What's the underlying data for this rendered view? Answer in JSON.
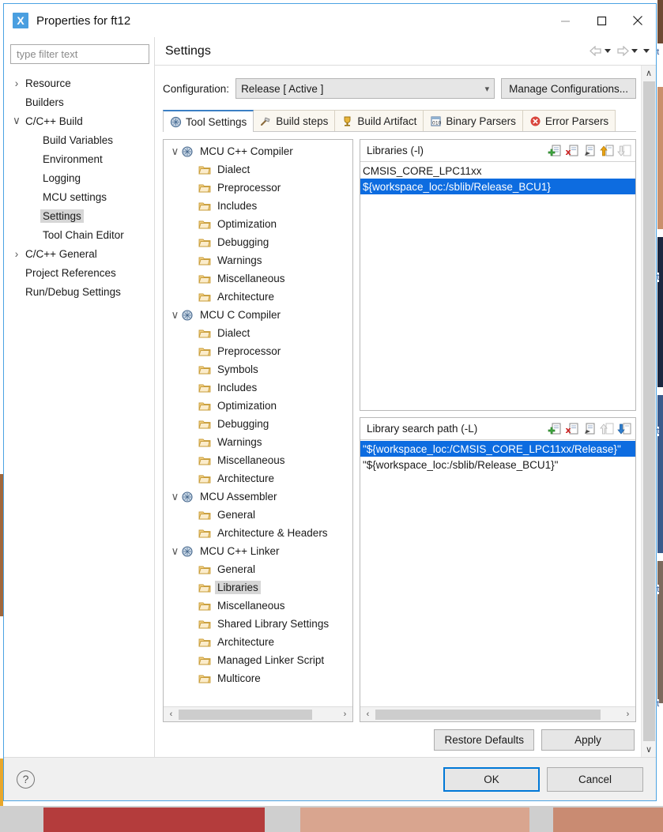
{
  "window": {
    "title": "Properties for ft12",
    "icon": "eclipse-x-icon",
    "minimize_label": "—",
    "maximize_label": "☐",
    "close_label": "✕"
  },
  "sidebar": {
    "filter_placeholder": "type filter text",
    "items": [
      {
        "label": "Resource",
        "indent": 0,
        "twisty": "collapsed",
        "selected": false
      },
      {
        "label": "Builders",
        "indent": 0,
        "twisty": "none",
        "selected": false
      },
      {
        "label": "C/C++ Build",
        "indent": 0,
        "twisty": "expanded",
        "selected": false
      },
      {
        "label": "Build Variables",
        "indent": 1,
        "twisty": "none",
        "selected": false
      },
      {
        "label": "Environment",
        "indent": 1,
        "twisty": "none",
        "selected": false
      },
      {
        "label": "Logging",
        "indent": 1,
        "twisty": "none",
        "selected": false
      },
      {
        "label": "MCU settings",
        "indent": 1,
        "twisty": "none",
        "selected": false
      },
      {
        "label": "Settings",
        "indent": 1,
        "twisty": "none",
        "selected": true
      },
      {
        "label": "Tool Chain Editor",
        "indent": 1,
        "twisty": "none",
        "selected": false
      },
      {
        "label": "C/C++ General",
        "indent": 0,
        "twisty": "collapsed",
        "selected": false
      },
      {
        "label": "Project References",
        "indent": 0,
        "twisty": "none",
        "selected": false
      },
      {
        "label": "Run/Debug Settings",
        "indent": 0,
        "twisty": "none",
        "selected": false
      }
    ]
  },
  "page": {
    "title": "Settings",
    "nav_back_icon": "arrow-left-icon",
    "nav_forward_icon": "arrow-right-icon",
    "nav_menu_icon": "chevron-down-icon"
  },
  "configuration": {
    "label": "Configuration:",
    "value": "Release  [ Active ]",
    "manage_label": "Manage Configurations..."
  },
  "tabs": [
    {
      "label": "Tool Settings",
      "icon": "wrench-icon",
      "active": true
    },
    {
      "label": "Build steps",
      "icon": "hammer-icon",
      "active": false
    },
    {
      "label": "Build Artifact",
      "icon": "trophy-icon",
      "active": false
    },
    {
      "label": "Binary Parsers",
      "icon": "binary-icon",
      "active": false
    },
    {
      "label": "Error Parsers",
      "icon": "error-circle-icon",
      "active": false
    }
  ],
  "tool_tree": [
    {
      "label": "MCU C++ Compiler",
      "indent": 0,
      "twisty": "expanded",
      "icon": "tool-icon",
      "selected": false
    },
    {
      "label": "Dialect",
      "indent": 1,
      "twisty": "none",
      "icon": "folder-icon",
      "selected": false
    },
    {
      "label": "Preprocessor",
      "indent": 1,
      "twisty": "none",
      "icon": "folder-icon",
      "selected": false
    },
    {
      "label": "Includes",
      "indent": 1,
      "twisty": "none",
      "icon": "folder-icon",
      "selected": false
    },
    {
      "label": "Optimization",
      "indent": 1,
      "twisty": "none",
      "icon": "folder-icon",
      "selected": false
    },
    {
      "label": "Debugging",
      "indent": 1,
      "twisty": "none",
      "icon": "folder-icon",
      "selected": false
    },
    {
      "label": "Warnings",
      "indent": 1,
      "twisty": "none",
      "icon": "folder-icon",
      "selected": false
    },
    {
      "label": "Miscellaneous",
      "indent": 1,
      "twisty": "none",
      "icon": "folder-icon",
      "selected": false
    },
    {
      "label": "Architecture",
      "indent": 1,
      "twisty": "none",
      "icon": "folder-icon",
      "selected": false
    },
    {
      "label": "MCU C Compiler",
      "indent": 0,
      "twisty": "expanded",
      "icon": "tool-icon",
      "selected": false
    },
    {
      "label": "Dialect",
      "indent": 1,
      "twisty": "none",
      "icon": "folder-icon",
      "selected": false
    },
    {
      "label": "Preprocessor",
      "indent": 1,
      "twisty": "none",
      "icon": "folder-icon",
      "selected": false
    },
    {
      "label": "Symbols",
      "indent": 1,
      "twisty": "none",
      "icon": "folder-icon",
      "selected": false
    },
    {
      "label": "Includes",
      "indent": 1,
      "twisty": "none",
      "icon": "folder-icon",
      "selected": false
    },
    {
      "label": "Optimization",
      "indent": 1,
      "twisty": "none",
      "icon": "folder-icon",
      "selected": false
    },
    {
      "label": "Debugging",
      "indent": 1,
      "twisty": "none",
      "icon": "folder-icon",
      "selected": false
    },
    {
      "label": "Warnings",
      "indent": 1,
      "twisty": "none",
      "icon": "folder-icon",
      "selected": false
    },
    {
      "label": "Miscellaneous",
      "indent": 1,
      "twisty": "none",
      "icon": "folder-icon",
      "selected": false
    },
    {
      "label": "Architecture",
      "indent": 1,
      "twisty": "none",
      "icon": "folder-icon",
      "selected": false
    },
    {
      "label": "MCU Assembler",
      "indent": 0,
      "twisty": "expanded",
      "icon": "tool-icon",
      "selected": false
    },
    {
      "label": "General",
      "indent": 1,
      "twisty": "none",
      "icon": "folder-icon",
      "selected": false
    },
    {
      "label": "Architecture & Headers",
      "indent": 1,
      "twisty": "none",
      "icon": "folder-icon",
      "selected": false
    },
    {
      "label": "MCU C++ Linker",
      "indent": 0,
      "twisty": "expanded",
      "icon": "tool-icon",
      "selected": false
    },
    {
      "label": "General",
      "indent": 1,
      "twisty": "none",
      "icon": "folder-icon",
      "selected": false
    },
    {
      "label": "Libraries",
      "indent": 1,
      "twisty": "none",
      "icon": "folder-icon",
      "selected": true
    },
    {
      "label": "Miscellaneous",
      "indent": 1,
      "twisty": "none",
      "icon": "folder-icon",
      "selected": false
    },
    {
      "label": "Shared Library Settings",
      "indent": 1,
      "twisty": "none",
      "icon": "folder-icon",
      "selected": false
    },
    {
      "label": "Architecture",
      "indent": 1,
      "twisty": "none",
      "icon": "folder-icon",
      "selected": false
    },
    {
      "label": "Managed Linker Script",
      "indent": 1,
      "twisty": "none",
      "icon": "folder-icon",
      "selected": false
    },
    {
      "label": "Multicore",
      "indent": 1,
      "twisty": "none",
      "icon": "folder-icon",
      "selected": false
    }
  ],
  "libraries_panel": {
    "title": "Libraries (-l)",
    "tools": [
      {
        "name": "add-icon",
        "state": "enabled"
      },
      {
        "name": "delete-icon",
        "state": "enabled"
      },
      {
        "name": "edit-icon",
        "state": "enabled"
      },
      {
        "name": "move-up-icon",
        "state": "enabled"
      },
      {
        "name": "move-down-icon",
        "state": "disabled"
      }
    ],
    "items": [
      {
        "value": "CMSIS_CORE_LPC11xx",
        "selected": false
      },
      {
        "value": "${workspace_loc:/sblib/Release_BCU1}",
        "selected": true
      }
    ]
  },
  "search_path_panel": {
    "title": "Library search path (-L)",
    "tools": [
      {
        "name": "add-icon",
        "state": "enabled"
      },
      {
        "name": "delete-icon",
        "state": "enabled"
      },
      {
        "name": "edit-icon",
        "state": "enabled"
      },
      {
        "name": "move-up-icon",
        "state": "disabled"
      },
      {
        "name": "move-down-icon",
        "state": "enabled"
      }
    ],
    "items": [
      {
        "value": "\"${workspace_loc:/CMSIS_CORE_LPC11xx/Release}\"",
        "selected": true
      },
      {
        "value": "\"${workspace_loc:/sblib/Release_BCU1}\"",
        "selected": false
      }
    ]
  },
  "page_buttons": {
    "restore_defaults": "Restore Defaults",
    "apply": "Apply"
  },
  "dialog_buttons": {
    "help_icon": "question-mark-icon",
    "ok": "OK",
    "cancel": "Cancel"
  },
  "scroll": {
    "up_arrow": "∧",
    "down_arrow": "∨",
    "left_arrow": "‹",
    "right_arrow": "›"
  },
  "background": {
    "page_label": "at"
  },
  "colors": {
    "selection_blue": "#0d6ce0",
    "dialog_border": "#4ba3e3",
    "accent_focus": "#0078d7",
    "tab_active_border": "#3b7fc4",
    "tree_selection_gray": "#d6d6d6"
  }
}
